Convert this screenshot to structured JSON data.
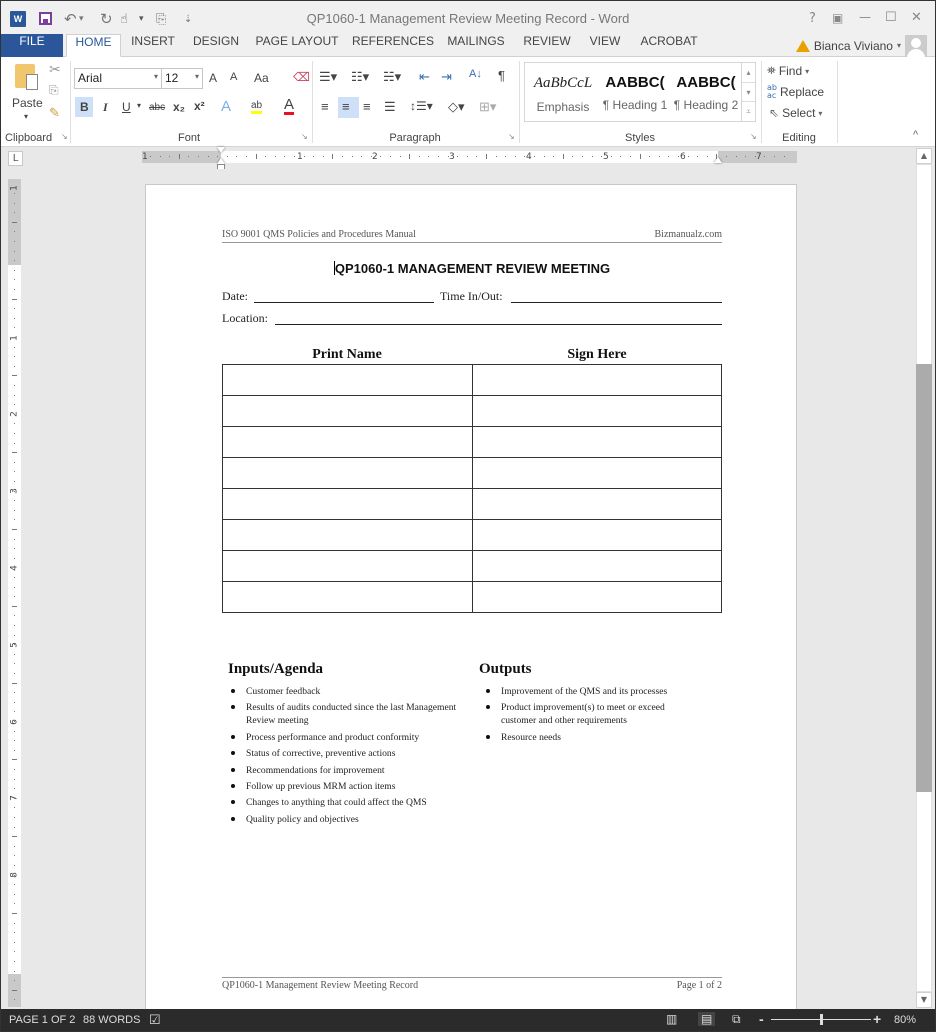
{
  "window": {
    "title": "QP1060-1 Management Review Meeting Record - Word",
    "app_icon": "W",
    "controls": {
      "help": "?",
      "ribbon_display": "▣",
      "minimize": "—",
      "maximize": "☐",
      "close": "✕"
    }
  },
  "quick_access": {
    "save": "save-icon",
    "undo": "↶",
    "redo": "↻",
    "touch": "touch-mode-icon",
    "customize": "⇣"
  },
  "tabs": [
    {
      "label": "FILE"
    },
    {
      "label": "HOME",
      "active": true
    },
    {
      "label": "INSERT"
    },
    {
      "label": "DESIGN"
    },
    {
      "label": "PAGE LAYOUT"
    },
    {
      "label": "REFERENCES"
    },
    {
      "label": "MAILINGS"
    },
    {
      "label": "REVIEW"
    },
    {
      "label": "VIEW"
    },
    {
      "label": "ACROBAT"
    }
  ],
  "user": {
    "name": "Bianca Viviano",
    "dropdown": "▾"
  },
  "ribbon": {
    "clipboard": {
      "label": "Clipboard",
      "paste": "Paste"
    },
    "font": {
      "label": "Font",
      "font_name": "Arial",
      "font_size": "12",
      "grow": "A",
      "shrink": "A",
      "change_case": "Aa",
      "bold": "B",
      "italic": "I",
      "underline": "U",
      "strikethrough": "abc",
      "subscript": "x₂",
      "superscript": "x²",
      "text_effects": "A",
      "highlight": "ab",
      "font_color": "A",
      "highlight_color": "#ffff00",
      "font_color_value": "#e81123"
    },
    "paragraph": {
      "label": "Paragraph",
      "sort": "A↓",
      "show_marks": "¶"
    },
    "styles": {
      "label": "Styles",
      "items": [
        {
          "preview": "AaBbCcL",
          "name": "Emphasis"
        },
        {
          "preview": "AABBC(",
          "name": "¶ Heading 1"
        },
        {
          "preview": "AABBC(",
          "name": "¶ Heading 2"
        }
      ]
    },
    "editing": {
      "label": "Editing",
      "find": "Find",
      "replace": "Replace",
      "select": "Select"
    },
    "collapse": "^"
  },
  "ruler": {
    "tab_selector": "L",
    "h_labels": [
      "1",
      "1",
      "2",
      "3",
      "4",
      "5",
      "6",
      "7"
    ],
    "v_labels": [
      "1",
      "1",
      "2",
      "3",
      "4",
      "5",
      "6",
      "7",
      "8"
    ]
  },
  "document": {
    "header_left": "ISO 9001 QMS Policies and Procedures Manual",
    "header_right": "Bizmanualz.com",
    "title": "QP1060-1 MANAGEMENT REVIEW MEETING",
    "date_label": "Date:",
    "time_label": "Time In/Out:",
    "location_label": "Location:",
    "table": {
      "headers": [
        "Print Name",
        "Sign Here"
      ],
      "row_count": 8
    },
    "inputs": {
      "heading": "Inputs/Agenda",
      "items": [
        "Customer feedback",
        "Results of audits conducted since the last Management Review meeting",
        "Process performance and product conformity",
        "Status of corrective, preventive actions",
        "Recommendations for improvement",
        "Follow up previous MRM action items",
        "Changes to anything that could affect the QMS",
        "Quality policy and objectives"
      ]
    },
    "outputs": {
      "heading": "Outputs",
      "items": [
        "Improvement of the QMS and its processes",
        "Product improvement(s) to meet or exceed customer and other requirements",
        "Resource needs"
      ]
    },
    "footer_left": "QP1060-1 Management Review Meeting Record",
    "footer_right": "Page 1 of 2"
  },
  "status_bar": {
    "page": "PAGE 1 OF 2",
    "words": "88 WORDS",
    "zoom_minus": "-",
    "zoom_plus": "+",
    "zoom": "80%"
  },
  "scroll": {
    "position_fraction": 0.5
  }
}
